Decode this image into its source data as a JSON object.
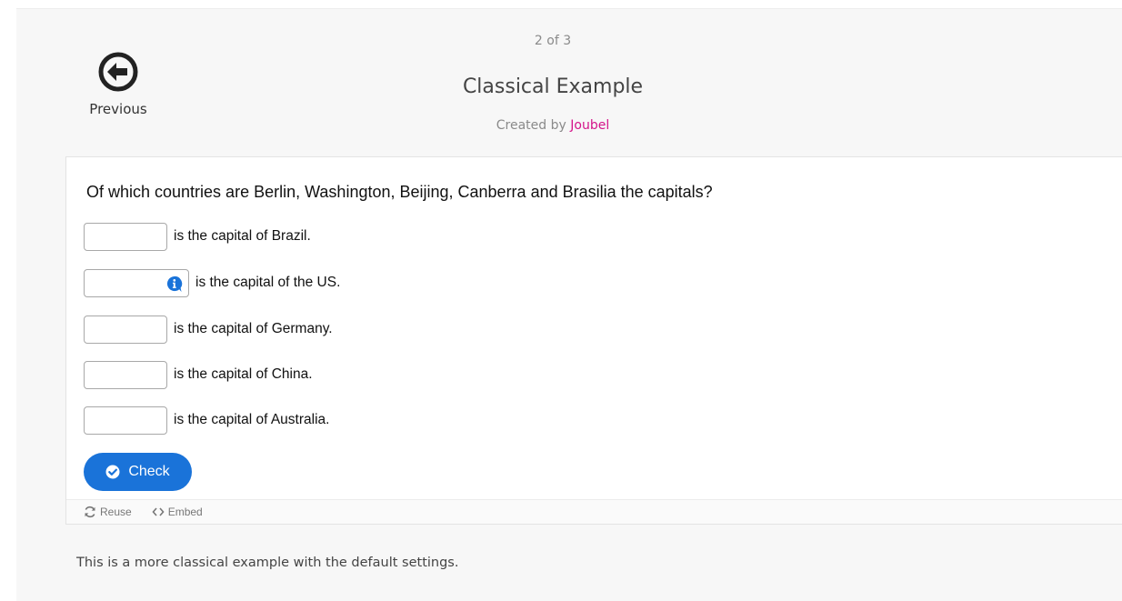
{
  "nav": {
    "previous_label": "Previous"
  },
  "header": {
    "pager": "2 of 3",
    "title": "Classical Example",
    "created_by_prefix": "Created by",
    "author": "Joubel"
  },
  "question": {
    "prompt": "Of which countries are Berlin, Washington, Beijing, Canberra and Brasilia the capitals?",
    "blanks": [
      {
        "value": "",
        "text": "is the capital of Brazil.",
        "has_tip": false
      },
      {
        "value": "",
        "text": "is the capital of the US.",
        "has_tip": true
      },
      {
        "value": "",
        "text": "is the capital of Germany.",
        "has_tip": false
      },
      {
        "value": "",
        "text": "is the capital of China.",
        "has_tip": false
      },
      {
        "value": "",
        "text": "is the capital of Australia.",
        "has_tip": false
      }
    ],
    "check_label": "Check"
  },
  "footer": {
    "reuse_label": "Reuse",
    "embed_label": "Embed"
  },
  "description": "This is a more classical example with the default settings.",
  "colors": {
    "accent_button": "#1a73d9",
    "author_link": "#d4148a",
    "tip_icon": "#1a73d9"
  },
  "icons": {
    "previous": "circle-arrow-left-icon",
    "tip": "info-icon",
    "check": "circle-check-icon",
    "reuse": "refresh-icon",
    "embed": "code-icon"
  }
}
